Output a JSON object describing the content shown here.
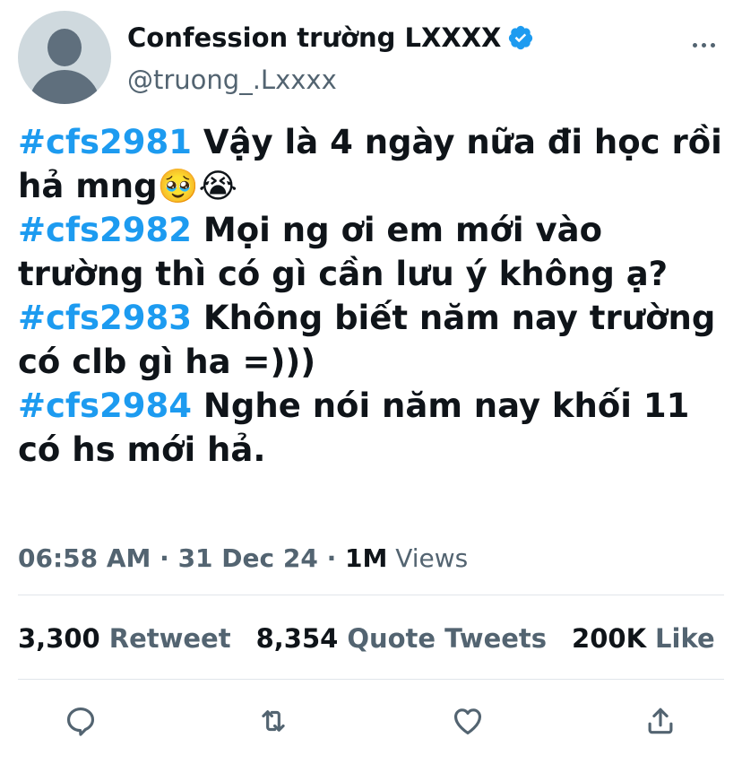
{
  "account": {
    "display_name": "Confession trường LXXXX",
    "handle": "@truong_.Lxxxx"
  },
  "tweet": {
    "lines": [
      {
        "hashtag": "#cfs2981",
        "text": " Vậy là 4 ngày nữa đi học rồi"
      },
      {
        "hashtag": "",
        "text": "hả mng🥹😭"
      },
      {
        "hashtag": "#cfs2982",
        "text": " Mọi ng ơi em mới vào"
      },
      {
        "hashtag": "",
        "text": "trường thì có gì cần lưu ý không ạ?"
      },
      {
        "hashtag": "#cfs2983",
        "text": " Không biết năm nay trường"
      },
      {
        "hashtag": "",
        "text": "có clb gì ha =)))"
      },
      {
        "hashtag": "#cfs2984",
        "text": " Nghe nói năm nay khối 11"
      },
      {
        "hashtag": "",
        "text": "có hs mới hả."
      }
    ]
  },
  "meta": {
    "time": "06:58 AM",
    "separator": " · ",
    "date": "31 Dec 24",
    "separator2": " · ",
    "views_count": "1M",
    "views_label": " Views"
  },
  "stats": {
    "retweets": {
      "count": "3,300",
      "label": "Retweet"
    },
    "quotes": {
      "count": "8,354",
      "label": "Quote Tweets"
    },
    "likes": {
      "count": "200K",
      "label": "Like"
    }
  },
  "colors": {
    "accent": "#1d9bf0",
    "secondary_text": "#536471",
    "primary_text": "#0f1419",
    "divider": "#e1e6ea"
  },
  "icons": {
    "verified": "verified-badge-icon",
    "more": "more-dots-icon",
    "reply": "reply-icon",
    "retweet": "retweet-icon",
    "like": "heart-icon",
    "share": "share-icon"
  }
}
